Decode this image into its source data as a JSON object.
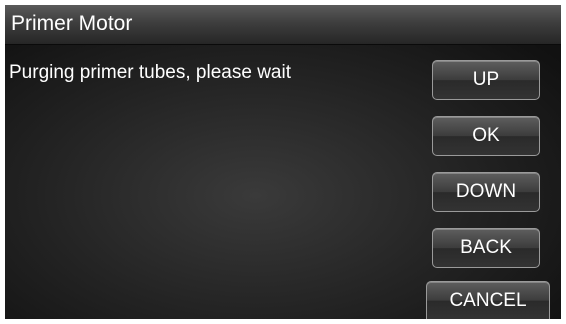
{
  "window": {
    "title": "Primer Motor"
  },
  "main": {
    "message": "Purging primer tubes, please wait"
  },
  "buttons": {
    "up": "UP",
    "ok": "OK",
    "down": "DOWN",
    "back": "BACK",
    "cancel": "CANCEL"
  },
  "colors": {
    "background": "#0c0c0c",
    "title_bar": "#3e3e3e",
    "text": "#ffffff",
    "button_border": "#9a9a9a"
  }
}
